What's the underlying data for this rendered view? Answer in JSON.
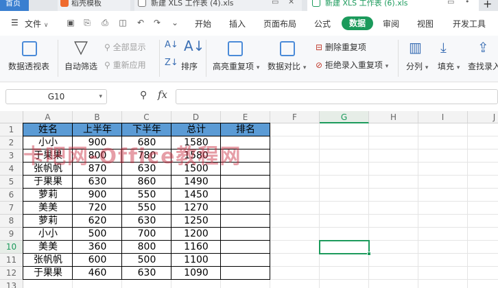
{
  "tabs": {
    "home": "首页",
    "t1": "稻壳模板",
    "t2": "新建 XLS 工作表 (4).xls",
    "t3": "新建 XLS 工作表 (6).xls",
    "add": "+"
  },
  "menu": {
    "file": "文件",
    "items": [
      "开始",
      "插入",
      "页面布局",
      "公式",
      "数据",
      "审阅",
      "视图",
      "开发工具"
    ]
  },
  "ribbon": {
    "pivot": "数据透视表",
    "autofilter": "自动筛选",
    "show_all": "全部显示",
    "reapply": "重新应用",
    "sort": "排序",
    "highlight_dup": "高亮重复项",
    "compare": "数据对比",
    "remove_dup": "删除重复项",
    "reject_dup": "拒绝录入重复项",
    "split": "分列",
    "fill": "填充",
    "find_input": "查找录入"
  },
  "formula_bar": {
    "name_box": "G10",
    "fx": "fx",
    "value": ""
  },
  "sheet": {
    "columns": [
      "A",
      "B",
      "C",
      "D",
      "E",
      "F",
      "G",
      "H",
      "I",
      "J"
    ],
    "selected_column": "G",
    "selected_row": "10",
    "rows": [
      "1",
      "2",
      "3",
      "4",
      "5",
      "6",
      "7",
      "8",
      "9",
      "10",
      "11",
      "12",
      "13"
    ],
    "header": [
      "姓名",
      "上半年",
      "下半年",
      "总计",
      "排名"
    ],
    "data": [
      [
        "小小",
        "900",
        "680",
        "1580",
        ""
      ],
      [
        "于果果",
        "800",
        "780",
        "1580",
        ""
      ],
      [
        "张帆帆",
        "870",
        "630",
        "1500",
        ""
      ],
      [
        "于果果",
        "630",
        "860",
        "1490",
        ""
      ],
      [
        "萝莉",
        "900",
        "550",
        "1450",
        ""
      ],
      [
        "美美",
        "720",
        "550",
        "1270",
        ""
      ],
      [
        "萝莉",
        "620",
        "630",
        "1250",
        ""
      ],
      [
        "小小",
        "500",
        "700",
        "1200",
        ""
      ],
      [
        "美美",
        "360",
        "800",
        "1160",
        ""
      ],
      [
        "张帆帆",
        "600",
        "500",
        "1100",
        ""
      ],
      [
        "于果果",
        "460",
        "630",
        "1090",
        ""
      ]
    ]
  },
  "watermark": "卡吧网-Office教程网",
  "colors": {
    "accent": "#1b9a5b",
    "header_fill": "#5b9bd5",
    "home_tab": "#3a7fd0"
  }
}
